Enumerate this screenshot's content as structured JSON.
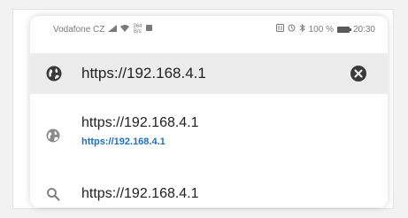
{
  "status_bar": {
    "carrier": "Vodafone CZ",
    "data_rate_top": "364",
    "data_rate_bottom": "B/s",
    "battery": "100 %",
    "time": "20:30"
  },
  "url_bar": {
    "value": "https://192.168.4.1",
    "left_icon": "globe-icon",
    "right_icon": "clear-icon"
  },
  "suggestions": [
    {
      "icon": "globe-icon",
      "title": "https://192.168.4.1",
      "subtitle": "https://192.168.4.1"
    },
    {
      "icon": "search-icon",
      "title": "https://192.168.4.1"
    }
  ],
  "colors": {
    "link": "#1a73c8",
    "url_bar_bg": "#ececec",
    "text": "#222222"
  }
}
